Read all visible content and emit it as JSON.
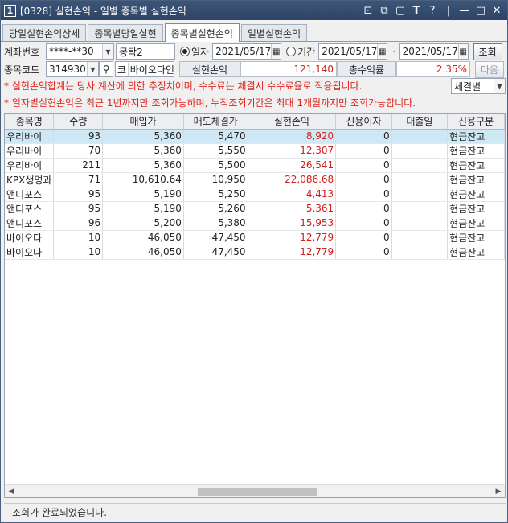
{
  "window": {
    "number": "1",
    "title": "[0328] 실현손익 - 일별 종목별 실현손익"
  },
  "tabs": [
    {
      "label": "당일실현손익상세"
    },
    {
      "label": "종목별당일실현"
    },
    {
      "label": "종목별실현손익",
      "active": true
    },
    {
      "label": "일별실현손익"
    }
  ],
  "form": {
    "account_label": "계좌번호",
    "account_value": "****-**30",
    "account_name": "몽탁2",
    "date_radio_label": "일자",
    "date_value": "2021/05/17",
    "period_radio_label": "기간",
    "period_from": "2021/05/17",
    "period_sep": "~",
    "period_to": "2021/05/17",
    "query_button": "조회",
    "code_label": "종목코드",
    "code_value": "314930",
    "code_prefix": "코",
    "code_name": "바이오다인",
    "realized_label": "실현손익",
    "realized_value": "121,140",
    "return_label": "총수익률",
    "return_value": "2.35%",
    "next_button": "다음",
    "filter_value": "체결별"
  },
  "notices": [
    "* 실현손익합계는 당사 계산에 의한 추정치이며, 수수료는 체결시 수수료율로 적용됩니다.",
    "* 일자별실현손익은 최근 1년까지만 조회가능하며, 누적조회기간은 최대 1개월까지만 조회가능합니다."
  ],
  "table": {
    "columns": [
      "종목명",
      "수량",
      "매입가",
      "매도체결가",
      "실현손익",
      "신용이자",
      "대출일",
      "신용구분"
    ],
    "rows": [
      [
        "우리바이",
        "93",
        "5,360",
        "5,470",
        "8,920",
        "0",
        "",
        "현금잔고"
      ],
      [
        "우리바이",
        "70",
        "5,360",
        "5,550",
        "12,307",
        "0",
        "",
        "현금잔고"
      ],
      [
        "우리바이",
        "211",
        "5,360",
        "5,500",
        "26,541",
        "0",
        "",
        "현금잔고"
      ],
      [
        "KPX생명과",
        "71",
        "10,610.64",
        "10,950",
        "22,086.68",
        "0",
        "",
        "현금잔고"
      ],
      [
        "앤디포스",
        "95",
        "5,190",
        "5,250",
        "4,413",
        "0",
        "",
        "현금잔고"
      ],
      [
        "앤디포스",
        "95",
        "5,190",
        "5,260",
        "5,361",
        "0",
        "",
        "현금잔고"
      ],
      [
        "앤디포스",
        "96",
        "5,200",
        "5,380",
        "15,953",
        "0",
        "",
        "현금잔고"
      ],
      [
        "바이오다",
        "10",
        "46,050",
        "47,450",
        "12,779",
        "0",
        "",
        "현금잔고"
      ],
      [
        "바이오다",
        "10",
        "46,050",
        "47,450",
        "12,779",
        "0",
        "",
        "현금잔고"
      ]
    ]
  },
  "status_text": "조회가 완료되었습니다.",
  "colors": {
    "accent": "#2d4466",
    "profit": "#d0211b",
    "selected_row": "#cfe8f5"
  }
}
